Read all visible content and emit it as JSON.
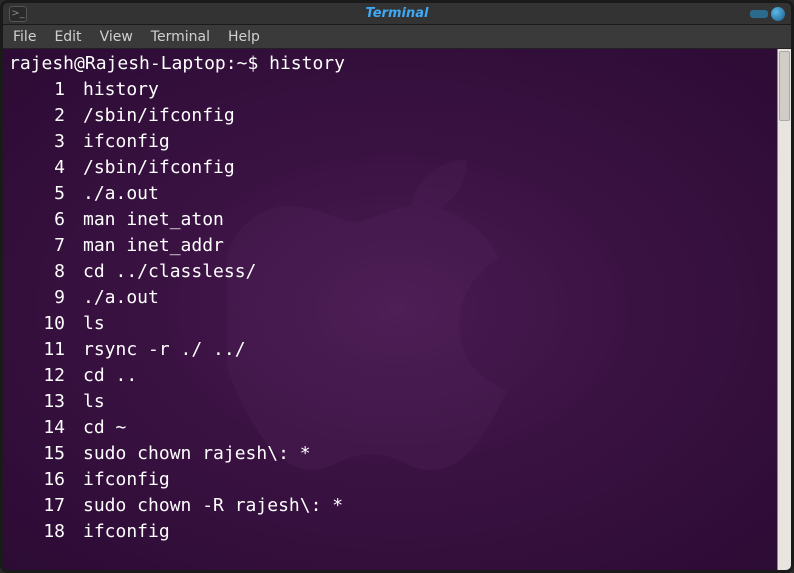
{
  "window": {
    "title": "Terminal"
  },
  "menubar": {
    "items": [
      "File",
      "Edit",
      "View",
      "Terminal",
      "Help"
    ]
  },
  "terminal": {
    "prompt_user_host": "rajesh@Rajesh-Laptop",
    "prompt_path": "~",
    "prompt_symbol": "$",
    "command": "history",
    "history": [
      {
        "n": "1",
        "cmd": "history"
      },
      {
        "n": "2",
        "cmd": "/sbin/ifconfig"
      },
      {
        "n": "3",
        "cmd": "ifconfig"
      },
      {
        "n": "4",
        "cmd": "/sbin/ifconfig"
      },
      {
        "n": "5",
        "cmd": "./a.out"
      },
      {
        "n": "6",
        "cmd": "man inet_aton"
      },
      {
        "n": "7",
        "cmd": "man inet_addr"
      },
      {
        "n": "8",
        "cmd": "cd ../classless/"
      },
      {
        "n": "9",
        "cmd": "./a.out"
      },
      {
        "n": "10",
        "cmd": "ls"
      },
      {
        "n": "11",
        "cmd": "rsync -r ./ ../"
      },
      {
        "n": "12",
        "cmd": "cd .."
      },
      {
        "n": "13",
        "cmd": "ls"
      },
      {
        "n": "14",
        "cmd": "cd ~"
      },
      {
        "n": "15",
        "cmd": "sudo chown rajesh\\: *"
      },
      {
        "n": "16",
        "cmd": "ifconfig"
      },
      {
        "n": "17",
        "cmd": "sudo chown -R rajesh\\: *"
      },
      {
        "n": "18",
        "cmd": "ifconfig"
      }
    ]
  }
}
